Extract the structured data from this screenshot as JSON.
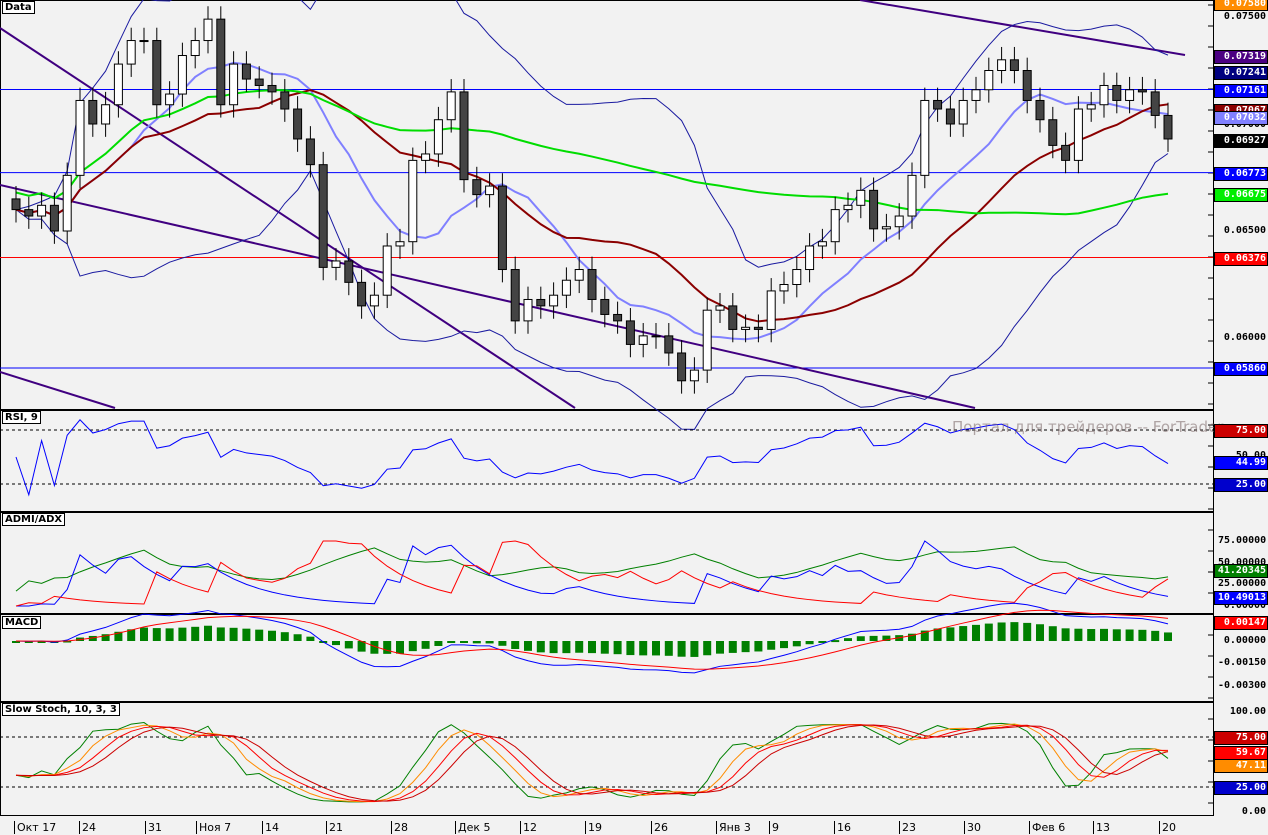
{
  "chart_data": {
    "type": "candlestick",
    "title": "Data",
    "x_labels": [
      "Окт 17",
      "24",
      "31",
      "Ноя 7",
      "14",
      "21",
      "28",
      "Дек 5",
      "12",
      "19",
      "26",
      "Янв 3",
      "9",
      "16",
      "23",
      "30",
      "Фев 6",
      "13",
      "20"
    ],
    "closes": [
      0.066,
      0.0657,
      0.0662,
      0.065,
      0.0676,
      0.0711,
      0.07,
      0.0709,
      0.0728,
      0.0739,
      0.0739,
      0.0709,
      0.0714,
      0.0732,
      0.0739,
      0.0749,
      0.0709,
      0.0728,
      0.0721,
      0.0718,
      0.0715,
      0.0707,
      0.0693,
      0.0681,
      0.0633,
      0.0636,
      0.0626,
      0.0615,
      0.062,
      0.0643,
      0.0645,
      0.0683,
      0.0686,
      0.0702,
      0.0715,
      0.0674,
      0.0667,
      0.0671,
      0.0632,
      0.0608,
      0.0618,
      0.0615,
      0.062,
      0.0627,
      0.0632,
      0.0618,
      0.0611,
      0.0608,
      0.0597,
      0.0601,
      0.0601,
      0.0593,
      0.058,
      0.0585,
      0.0613,
      0.0615,
      0.0604,
      0.0605,
      0.0604,
      0.0622,
      0.0625,
      0.0632,
      0.0643,
      0.0645,
      0.066,
      0.0662,
      0.0669,
      0.0651,
      0.0652,
      0.0657,
      0.0676,
      0.0711,
      0.0707,
      0.07,
      0.0711,
      0.0716,
      0.0725,
      0.073,
      0.0725,
      0.0711,
      0.0702,
      0.069,
      0.0683,
      0.0707,
      0.0709,
      0.0718,
      0.0711,
      0.0716,
      0.0715,
      0.0704,
      0.0693
    ],
    "price_axis": {
      "ylim": [
        0.0573,
        0.076
      ],
      "ticks": [
        "0.07500",
        "0.07000",
        "0.06500",
        "0.06000"
      ]
    },
    "levels": [
      {
        "value": "0.07161",
        "color": "#0000ff"
      },
      {
        "value": "0.06773",
        "color": "#0000ff"
      },
      {
        "value": "0.06376",
        "color": "#ff0000"
      },
      {
        "value": "0.05860",
        "color": "#0000ff"
      }
    ],
    "price_tags": [
      {
        "text": "0.07580",
        "bg": "#ff8c00"
      },
      {
        "text": "0.07319",
        "bg": "#4b0082"
      },
      {
        "text": "0.07241",
        "bg": "#00007f"
      },
      {
        "text": "0.07161",
        "bg": "#0000ff"
      },
      {
        "text": "0.07067",
        "bg": "#8b0000"
      },
      {
        "text": "0.07032",
        "bg": "#8080ff"
      },
      {
        "text": "0.06927",
        "bg": "#000000"
      },
      {
        "text": "0.06773",
        "bg": "#0000ff"
      },
      {
        "text": "0.06675",
        "bg": "#00ee00"
      },
      {
        "text": "0.06376",
        "bg": "#ff0000"
      },
      {
        "text": "0.05860",
        "bg": "#0000ff"
      }
    ],
    "indicators": {
      "rsi": {
        "label": "RSI, 9",
        "ticks": [
          "50.00"
        ],
        "tags": [
          {
            "text": "75.00",
            "bg": "#cc0000"
          },
          {
            "text": "44.99",
            "bg": "#0000ff"
          },
          {
            "text": "25.00",
            "bg": "#0000cc"
          }
        ]
      },
      "adx": {
        "label": "ADMI/ADX",
        "ticks": [
          "75.00000",
          "50.00000",
          "25.00000",
          "0.00000"
        ],
        "tags": [
          {
            "text": "41.20345",
            "bg": "#008000"
          },
          {
            "text": "10.49013",
            "bg": "#0000ff"
          }
        ]
      },
      "macd": {
        "label": "MACD",
        "ticks": [
          "0.00000",
          "-0.00150",
          "-0.00300"
        ],
        "tags": [
          {
            "text": "0.00147",
            "bg": "#ff0000"
          }
        ]
      },
      "stoch": {
        "label": "Slow Stoch, 10, 3, 3",
        "ticks": [
          "100.00",
          "0.00"
        ],
        "tags": [
          {
            "text": "75.00",
            "bg": "#cc0000"
          },
          {
            "text": "59.67",
            "bg": "#ff0000"
          },
          {
            "text": "47.11",
            "bg": "#ff8c00"
          },
          {
            "text": "25.00",
            "bg": "#0000cc"
          }
        ]
      }
    }
  },
  "watermark": "Портал для трейдеров -- ForTrader"
}
